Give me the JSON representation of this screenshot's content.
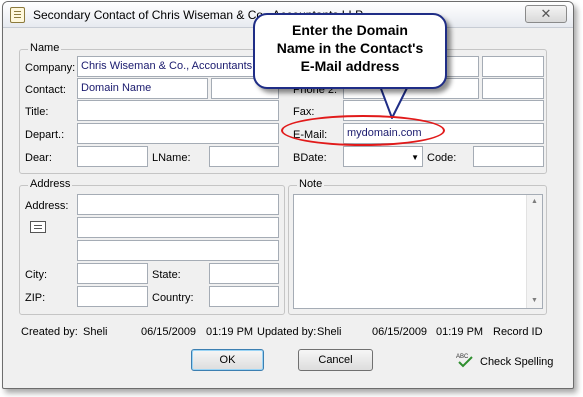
{
  "window": {
    "title": "Secondary Contact of Chris Wiseman & Co., Accountants LLP",
    "close_glyph": "✕"
  },
  "name_group": {
    "label": "Name",
    "company_label": "Company:",
    "company_value": "Chris Wiseman & Co., Accountants LLP",
    "contact_label": "Contact:",
    "contact_value": "Domain Name",
    "title_label": "Title:",
    "title_value": "",
    "depart_label": "Depart.:",
    "depart_value": "",
    "dear_label": "Dear:",
    "dear_value": "",
    "lname_label": "LName:",
    "lname_value": "",
    "phone2_label": "Phone 2:",
    "fax_label": "Fax:",
    "email_label": "E-Mail:",
    "email_value": "mydomain.com",
    "bdate_label": "BDate:",
    "bdate_value": "",
    "code_label": "Code:",
    "code_value": ""
  },
  "address_group": {
    "label": "Address",
    "address_label": "Address:",
    "city_label": "City:",
    "state_label": "State:",
    "zip_label": "ZIP:",
    "country_label": "Country:"
  },
  "note_group": {
    "label": "Note",
    "scroll_up": "▲",
    "scroll_down": "▼"
  },
  "footer": {
    "created_by_label": "Created by:",
    "created_by_user": "Sheli",
    "created_date": "06/15/2009",
    "created_time": "01:19 PM",
    "updated_by_label": "Updated by:",
    "updated_by_user": "Sheli",
    "updated_date": "06/15/2009",
    "updated_time": "01:19 PM",
    "record_id_label": "Record ID"
  },
  "buttons": {
    "ok": "OK",
    "cancel": "Cancel",
    "check_spelling": "Check Spelling",
    "spell_abc": "ABC"
  },
  "callout": {
    "line1": "Enter the Domain",
    "line2": "Name in the Contact's",
    "line3": "E-Mail address"
  },
  "colors": {
    "callout_border": "#1f2d86",
    "highlight": "#e11a1a",
    "field_text": "#1a1a6e"
  }
}
